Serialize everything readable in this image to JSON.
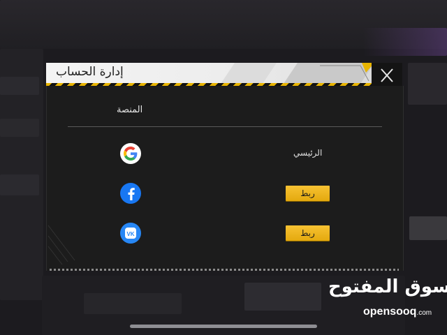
{
  "dialog": {
    "title": "إدارة الحساب",
    "column_header": "المنصة"
  },
  "accounts": [
    {
      "platform": "google",
      "icon": "google-icon",
      "status": "الرئيسي"
    },
    {
      "platform": "facebook",
      "icon": "facebook-icon",
      "action_label": "ربط"
    },
    {
      "platform": "vk",
      "icon": "vk-icon",
      "action_label": "ربط"
    }
  ],
  "watermark": {
    "arabic": "السوق المفتوح",
    "latin": "opensooq",
    "suffix": ".com"
  },
  "colors": {
    "accent_yellow": "#f2b81f",
    "panel_bg": "#1c1c1c",
    "header_bg": "#efefef",
    "facebook_blue": "#1877f2",
    "vk_blue": "#2787f5"
  }
}
